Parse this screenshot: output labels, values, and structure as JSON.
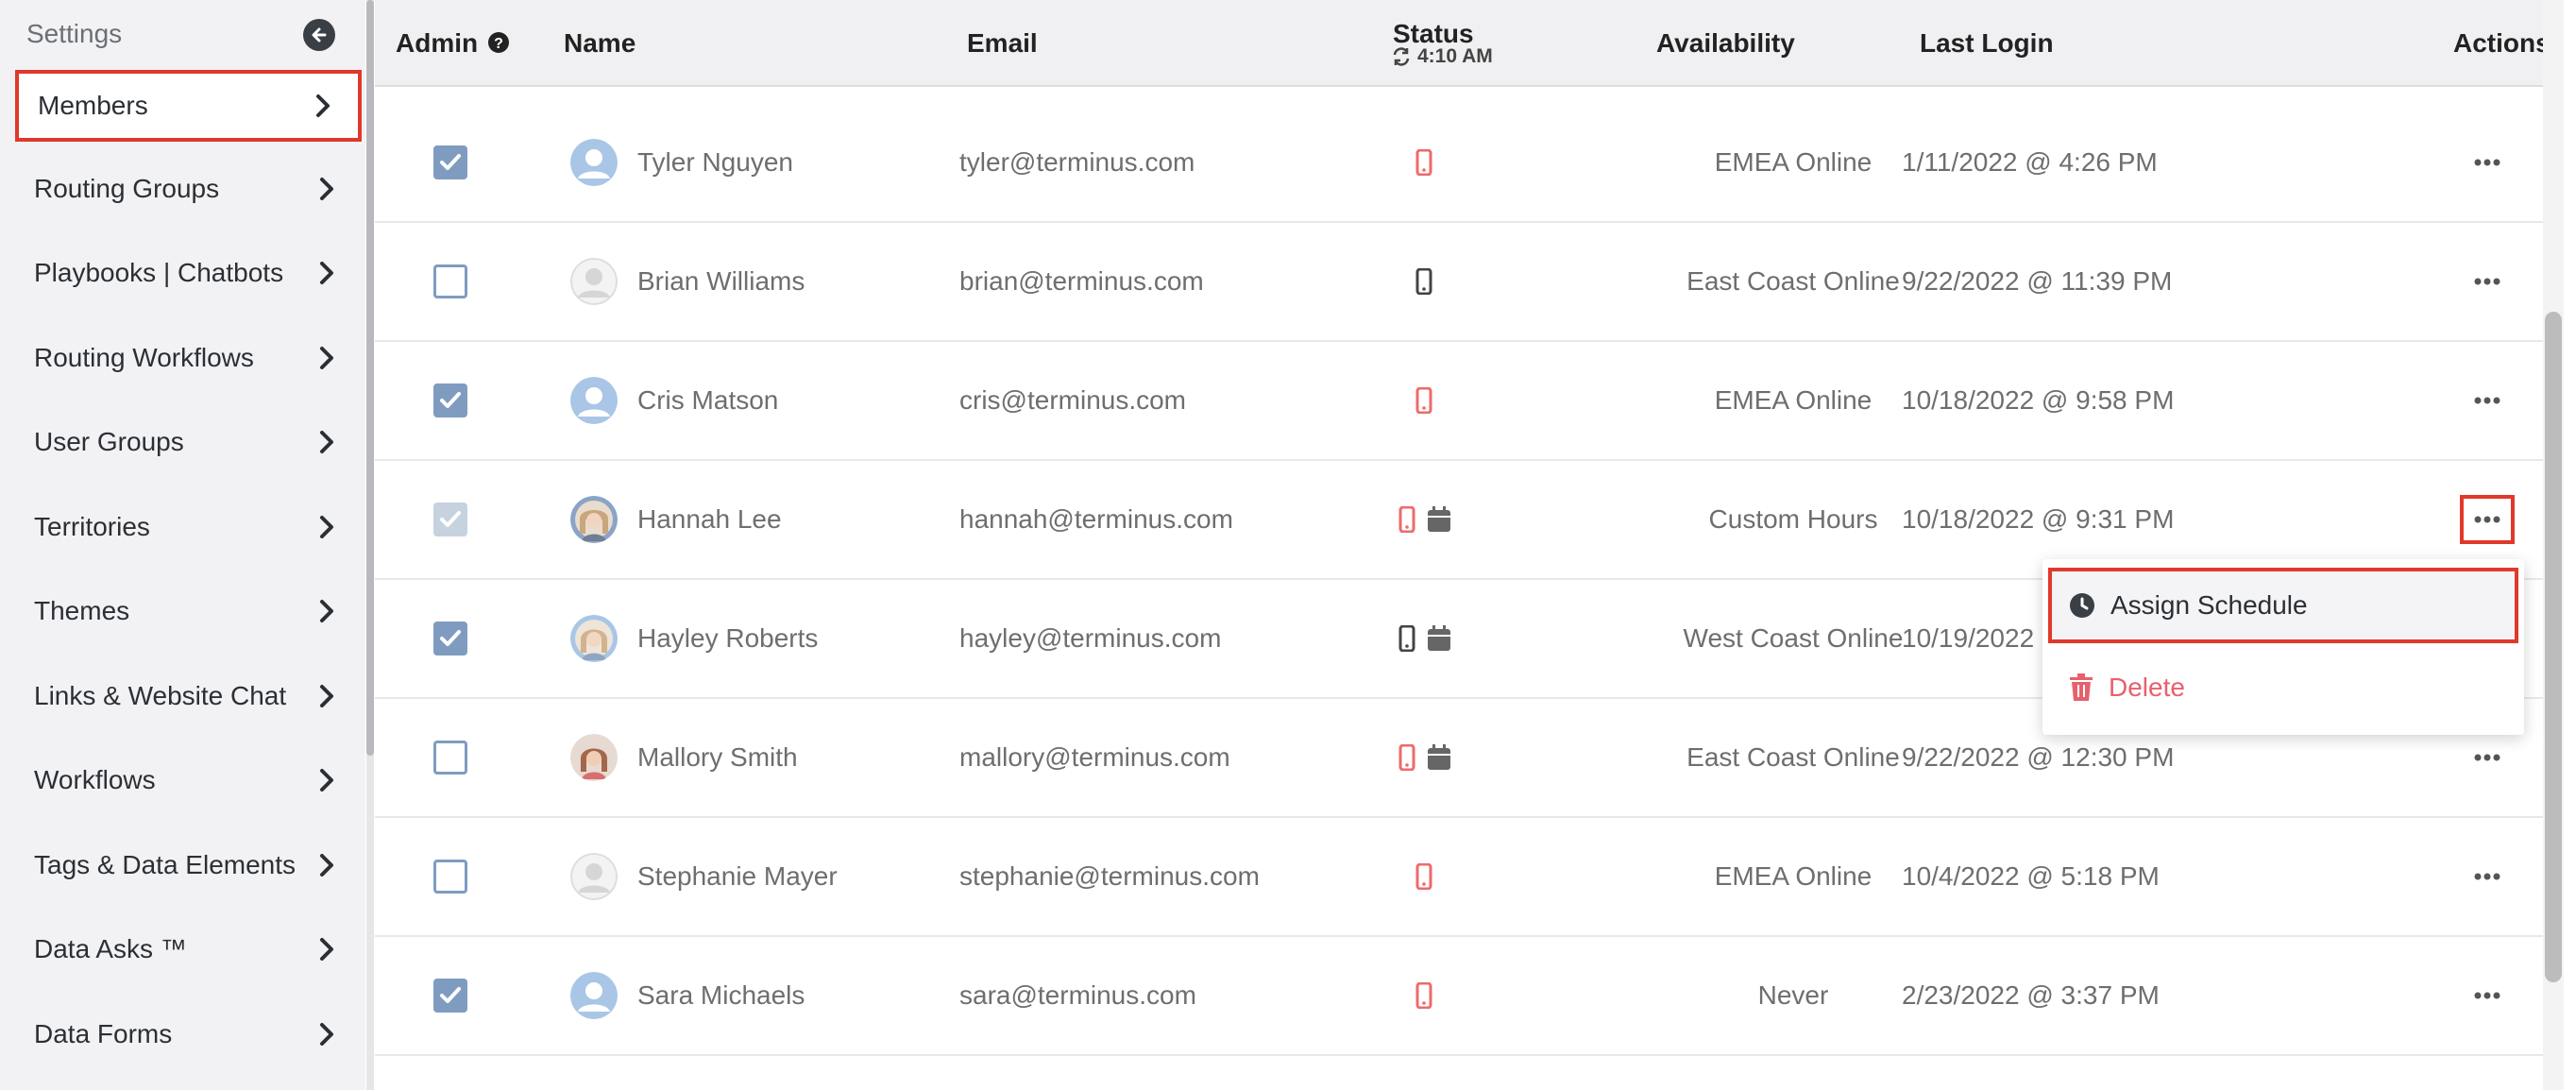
{
  "sidebar": {
    "title": "Settings",
    "items": [
      {
        "label": "Members"
      },
      {
        "label": "Routing Groups"
      },
      {
        "label": "Playbooks | Chatbots"
      },
      {
        "label": "Routing Workflows"
      },
      {
        "label": "User Groups"
      },
      {
        "label": "Territories"
      },
      {
        "label": "Themes"
      },
      {
        "label": "Links & Website Chat"
      },
      {
        "label": "Workflows"
      },
      {
        "label": "Tags & Data Elements"
      },
      {
        "label": "Data Asks ™"
      },
      {
        "label": "Data Forms"
      }
    ]
  },
  "table": {
    "headers": {
      "admin": "Admin",
      "name": "Name",
      "email": "Email",
      "status": "Status",
      "status_time": "4:10 AM",
      "availability": "Availability",
      "last_login": "Last Login",
      "actions": "Actions"
    },
    "rows": [
      {
        "admin": "checked",
        "name": "Tyler Nguyen",
        "email": "tyler@terminus.com",
        "status": "mobile-red",
        "calendar": false,
        "availability": "EMEA Online",
        "last_login": "1/11/2022 @ 4:26 PM"
      },
      {
        "admin": "unchecked",
        "name": "Brian Williams",
        "email": "brian@terminus.com",
        "status": "mobile-gray",
        "calendar": false,
        "availability": "East Coast Online",
        "last_login": "9/22/2022 @ 11:39 PM"
      },
      {
        "admin": "checked",
        "name": "Cris Matson",
        "email": "cris@terminus.com",
        "status": "mobile-red",
        "calendar": false,
        "availability": "EMEA Online",
        "last_login": "10/18/2022 @ 9:58 PM"
      },
      {
        "admin": "checked-disabled",
        "name": "Hannah Lee",
        "email": "hannah@terminus.com",
        "status": "mobile-red",
        "calendar": true,
        "availability": "Custom Hours",
        "last_login": "10/18/2022 @ 9:31 PM"
      },
      {
        "admin": "checked",
        "name": "Hayley Roberts",
        "email": "hayley@terminus.com",
        "status": "mobile-gray",
        "calendar": true,
        "availability": "West Coast Online",
        "last_login": "10/19/2022"
      },
      {
        "admin": "unchecked",
        "name": "Mallory Smith",
        "email": "mallory@terminus.com",
        "status": "mobile-red",
        "calendar": true,
        "availability": "East Coast Online",
        "last_login": "9/22/2022 @ 12:30 PM"
      },
      {
        "admin": "unchecked",
        "name": "Stephanie Mayer",
        "email": "stephanie@terminus.com",
        "status": "mobile-red",
        "calendar": false,
        "availability": "EMEA Online",
        "last_login": "10/4/2022 @ 5:18 PM"
      },
      {
        "admin": "checked",
        "name": "Sara Michaels",
        "email": "sara@terminus.com",
        "status": "mobile-red",
        "calendar": false,
        "availability": "Never",
        "last_login": "2/23/2022 @ 3:37 PM"
      }
    ]
  },
  "menu": {
    "assign_schedule": "Assign Schedule",
    "delete": "Delete"
  },
  "colors": {
    "accent_red": "#e0392b",
    "checkbox_blue": "#7f9cc0",
    "delete_red": "#e8606d",
    "status_red": "#ef6a6a"
  }
}
